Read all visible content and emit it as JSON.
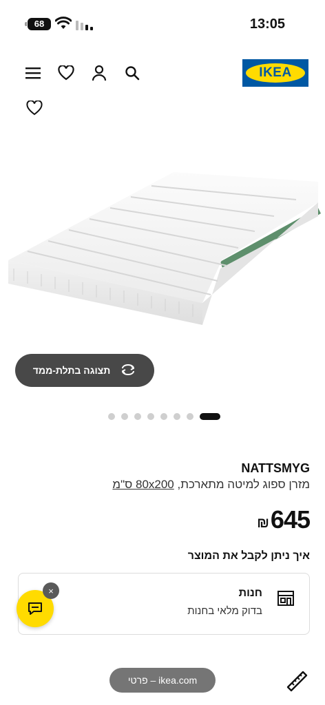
{
  "status_bar": {
    "time": "13:05",
    "battery": "68"
  },
  "header": {
    "logo_text": "IKEA",
    "icons": [
      "menu-icon",
      "heart-icon",
      "user-icon",
      "search-icon"
    ]
  },
  "gallery": {
    "view_3d_label": "תצוגה בתלת-ממד",
    "dot_count": 8,
    "active_dot": 0
  },
  "product": {
    "name": "NATTSMYG",
    "description": "מזרן ספוג למיטה מתארכת,",
    "size_link": "80x200 ס\"מ",
    "price_amount": "645",
    "currency": "₪"
  },
  "delivery": {
    "title": "איך ניתן לקבל את המוצר",
    "store_title": "חנות",
    "store_subtitle": "בדוק מלאי בחנות"
  },
  "chat": {
    "close_label": "×"
  },
  "browser": {
    "url_label": "ikea.com – פרטי"
  },
  "colors": {
    "brand_blue": "#0058a3",
    "brand_yellow": "#ffdb00",
    "dark_button": "#484848"
  }
}
